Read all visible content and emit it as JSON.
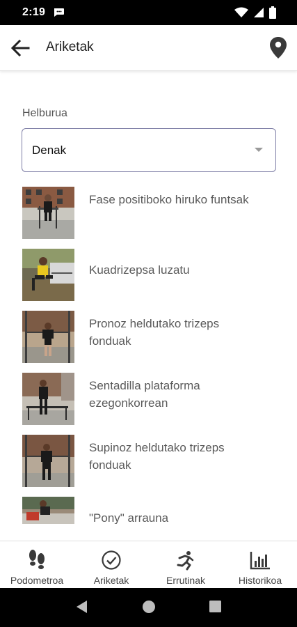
{
  "status_bar": {
    "time": "2:19"
  },
  "app_bar": {
    "title": "Ariketak"
  },
  "filter": {
    "label": "Helburua",
    "value": "Denak"
  },
  "exercises": [
    {
      "name": "Fase positiboko hiruko funtsak"
    },
    {
      "name": "Kuadrizepsa luzatu"
    },
    {
      "name": "Pronoz heldutako trizeps fonduak"
    },
    {
      "name": "Sentadilla plataforma ezegonkorrean"
    },
    {
      "name": "Supinoz heldutako trizeps fonduak"
    },
    {
      "name": "\"Pony\" arrauna"
    }
  ],
  "bottom_nav": [
    {
      "label": "Podometroa",
      "icon": "footprints-icon"
    },
    {
      "label": "Ariketak",
      "icon": "check-circle-icon"
    },
    {
      "label": "Errutinak",
      "icon": "running-icon"
    },
    {
      "label": "Historikoa",
      "icon": "bar-chart-icon"
    }
  ],
  "colors": {
    "select_border": "#7e7ea6",
    "text_secondary": "#5a5a5a"
  }
}
